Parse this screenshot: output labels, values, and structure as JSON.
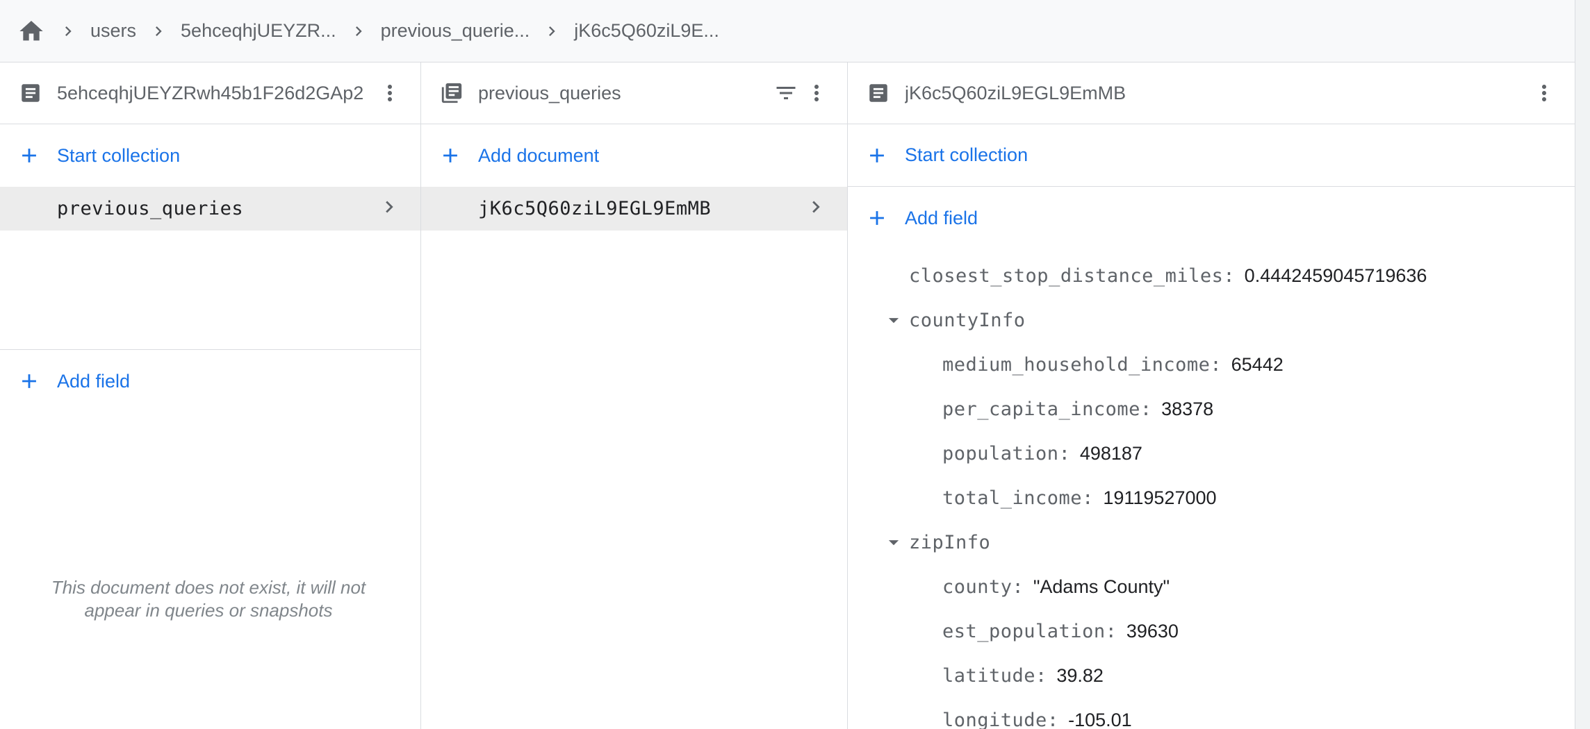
{
  "breadcrumb": {
    "items": [
      "users",
      "5ehceqhjUEYZR...",
      "previous_querie...",
      "jK6c5Q60ziL9E..."
    ]
  },
  "panel1": {
    "title": "5ehceqhjUEYZRwh45b1F26d2GAp2",
    "start_collection": "Start collection",
    "collections": [
      "previous_queries"
    ],
    "add_field": "Add field",
    "empty_message": "This document does not exist, it will not appear in queries or snapshots"
  },
  "panel2": {
    "title": "previous_queries",
    "add_document": "Add document",
    "documents": [
      "jK6c5Q60ziL9EGL9EmMB"
    ]
  },
  "panel3": {
    "title": "jK6c5Q60ziL9EGL9EmMB",
    "start_collection": "Start collection",
    "add_field": "Add field",
    "fields": {
      "closest_stop_distance_miles": {
        "key": "closest_stop_distance_miles",
        "value": "0.4442459045719636"
      },
      "countyInfo": {
        "key": "countyInfo",
        "children": [
          {
            "key": "medium_household_income",
            "value": "65442"
          },
          {
            "key": "per_capita_income",
            "value": "38378"
          },
          {
            "key": "population",
            "value": "498187"
          },
          {
            "key": "total_income",
            "value": "19119527000"
          }
        ]
      },
      "zipInfo": {
        "key": "zipInfo",
        "children": [
          {
            "key": "county",
            "value": "\"Adams County\""
          },
          {
            "key": "est_population",
            "value": "39630"
          },
          {
            "key": "latitude",
            "value": "39.82"
          },
          {
            "key": "longitude",
            "value": "-105.01"
          }
        ]
      }
    }
  },
  "colors": {
    "accent": "#1a73e8",
    "selected_row": "#ececec",
    "border": "#dadce0",
    "muted_text": "#5f6368"
  },
  "icons": [
    "home-icon",
    "chevron-right-icon",
    "document-icon",
    "collection-icon",
    "filter-icon",
    "more-vert-icon",
    "add-icon",
    "arrow-drop-down-icon"
  ]
}
